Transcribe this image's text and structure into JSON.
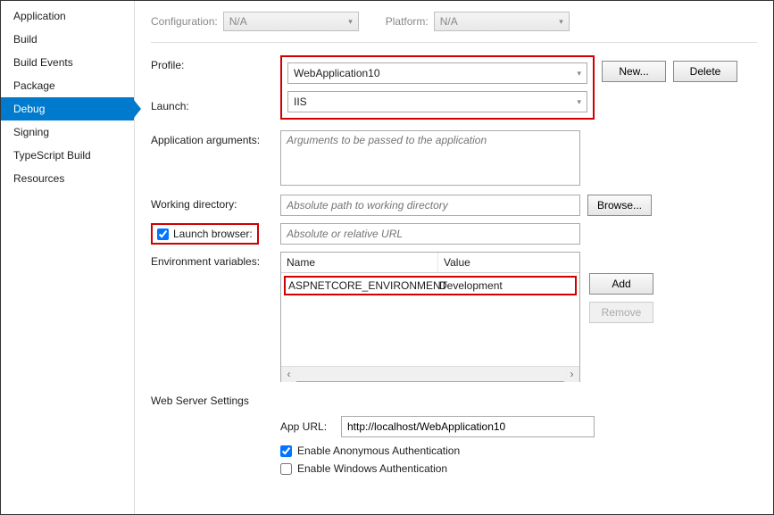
{
  "sidebar": {
    "items": [
      {
        "label": "Application"
      },
      {
        "label": "Build"
      },
      {
        "label": "Build Events"
      },
      {
        "label": "Package"
      },
      {
        "label": "Debug"
      },
      {
        "label": "Signing"
      },
      {
        "label": "TypeScript Build"
      },
      {
        "label": "Resources"
      }
    ],
    "active_index": 4
  },
  "config_bar": {
    "configuration_label": "Configuration:",
    "configuration_value": "N/A",
    "platform_label": "Platform:",
    "platform_value": "N/A"
  },
  "labels": {
    "profile": "Profile:",
    "launch": "Launch:",
    "app_args": "Application arguments:",
    "working_dir": "Working directory:",
    "launch_browser": "Launch browser:",
    "env_vars": "Environment variables:",
    "web_server": "Web Server Settings",
    "app_url": "App URL:",
    "enable_anon": "Enable Anonymous Authentication",
    "enable_win": "Enable Windows Authentication"
  },
  "buttons": {
    "new": "New...",
    "delete": "Delete",
    "browse": "Browse...",
    "add": "Add",
    "remove": "Remove"
  },
  "fields": {
    "profile_value": "WebApplication10",
    "launch_value": "IIS",
    "app_args_placeholder": "Arguments to be passed to the application",
    "working_dir_placeholder": "Absolute path to working directory",
    "launch_browser_placeholder": "Absolute or relative URL",
    "app_url_value": "http://localhost/WebApplication10"
  },
  "env_grid": {
    "col_name": "Name",
    "col_value": "Value",
    "rows": [
      {
        "name": "ASPNETCORE_ENVIRONMENT",
        "value": "Development"
      }
    ]
  },
  "checkboxes": {
    "launch_browser_checked": true,
    "enable_anon_checked": true,
    "enable_win_checked": false
  }
}
